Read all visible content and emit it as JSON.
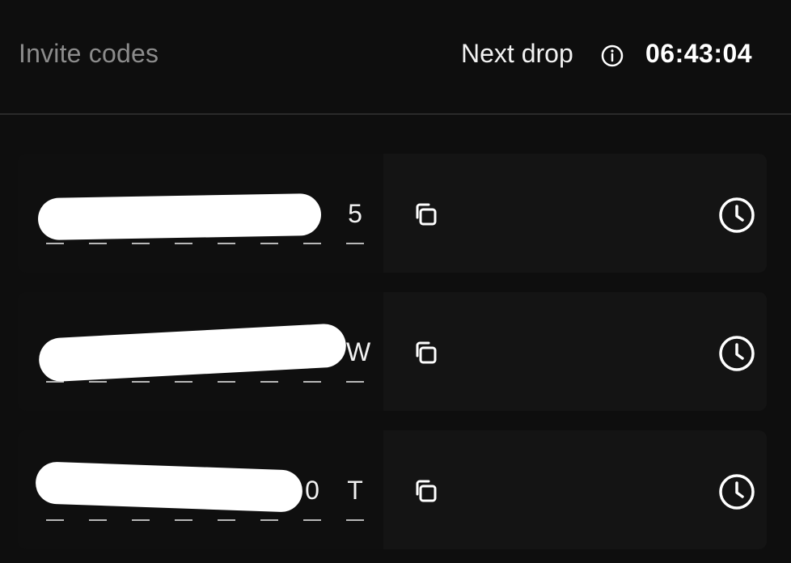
{
  "header": {
    "title": "Invite codes",
    "next_drop_label": "Next drop",
    "countdown": "06:43:04",
    "info_icon": "info-circle-icon"
  },
  "codes": [
    {
      "chars": [
        "",
        "",
        "",
        "",
        "",
        "",
        "",
        "5"
      ],
      "redacted": true,
      "copy_icon": "copy-icon",
      "expiry_icon": "clock-icon"
    },
    {
      "chars": [
        "",
        "",
        "",
        "",
        "",
        "",
        "",
        "W"
      ],
      "redacted": true,
      "copy_icon": "copy-icon",
      "expiry_icon": "clock-icon"
    },
    {
      "chars": [
        "",
        "",
        "",
        "",
        "",
        "",
        "0",
        "T"
      ],
      "redacted": true,
      "copy_icon": "copy-icon",
      "expiry_icon": "clock-icon"
    }
  ],
  "colors": {
    "background": "#0e0e0e",
    "card": "#141414",
    "muted_text": "#8c8c8c",
    "text": "#ffffff"
  }
}
